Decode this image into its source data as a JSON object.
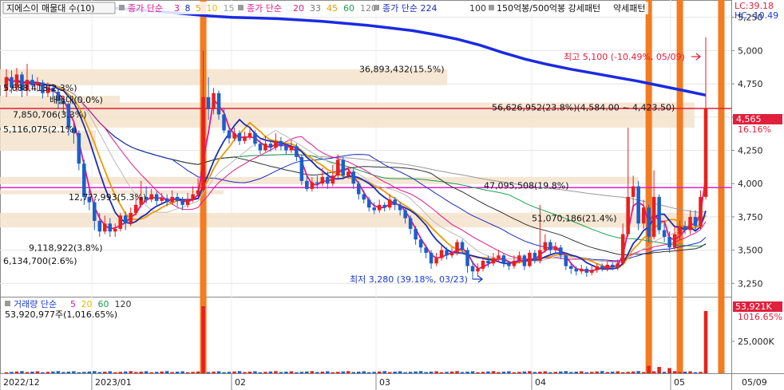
{
  "legend": {
    "title": "지에스이 매물대 수(10)",
    "ma1": {
      "label": "종가 단순",
      "periods": [
        {
          "v": "3",
          "color": "#e0188c"
        },
        {
          "v": "8",
          "color": "#1a2bbd"
        },
        {
          "v": "5",
          "color": "#e89a00"
        },
        {
          "v": "10",
          "color": "#e0c000"
        },
        {
          "v": "15",
          "color": "#9a9a9a"
        }
      ]
    },
    "ma2": {
      "label": "종가 단순",
      "periods": [
        {
          "v": "20",
          "color": "#d4208a"
        },
        {
          "v": "33",
          "color": "#777777"
        },
        {
          "v": "45",
          "color": "#e89a00"
        },
        {
          "v": "60",
          "color": "#1aa050"
        },
        {
          "v": "120",
          "color": "#888888"
        }
      ]
    },
    "ma3": {
      "label": "종가 단순 224",
      "periods": [
        {
          "v": "100",
          "color": "#333333"
        }
      ]
    },
    "pattern": "150억봉/500억봉 강세패턴",
    "pattern2": "약세패턴"
  },
  "top_right": {
    "lc": "LC:39.18",
    "hc": "HC:-10.49"
  },
  "price_axis": [
    "5,250",
    "5,000",
    "4,750",
    "4,500",
    "4,250",
    "4,000",
    "3,750",
    "3,500",
    "3,250"
  ],
  "current_price": {
    "value": "4,565",
    "change": "16.16%"
  },
  "volume_axis": [
    "25,000K"
  ],
  "current_volume": {
    "value": "53,921K",
    "change": "1016.65%"
  },
  "date_axis": [
    "2022/12",
    "2023/01",
    "02",
    "03",
    "04",
    "05",
    "05/09"
  ],
  "volume_legend": {
    "label": "거래량 단순",
    "periods": [
      {
        "v": "5",
        "color": "#e0188c"
      },
      {
        "v": "20",
        "color": "#e0c000"
      },
      {
        "v": "60",
        "color": "#1aa050"
      },
      {
        "v": "120",
        "color": "#333333"
      }
    ],
    "value": "53,920,977주(1,016.65%)"
  },
  "annotations": {
    "high": "최고 5,100 (-10.49%, 05/09)",
    "low": "최저 3,280 (39.18%, 03/23)",
    "vol_profile": [
      "36,893,432(15.5%)",
      "5,688,413(2.3%)",
      "배물대(0.0%)",
      "56,626,952(23.8%)(4,584.00 ~ 4,423.50)",
      "7,850,706(3.3%)",
      "5,116,075(2.1%)",
      "47,095,508(19.8%)",
      "12,7??,993(5.3%)",
      "51,070,186(21.4%)",
      "9,118,922(3.8%)",
      "6,134,700(2.6%)"
    ]
  },
  "chart_data": {
    "type": "candlestick",
    "price_ylim": [
      3150,
      5380
    ],
    "horizontal_lines": [
      {
        "value": 4565,
        "color": "#e0203c"
      },
      {
        "value": 3970,
        "color": "#e020c8"
      }
    ],
    "bars": [
      {
        "o": 4700,
        "c": 4800,
        "h": 4860,
        "l": 4650
      },
      {
        "o": 4800,
        "c": 4720,
        "h": 4850,
        "l": 4680
      },
      {
        "o": 4720,
        "c": 4820,
        "h": 4870,
        "l": 4690
      },
      {
        "o": 4820,
        "c": 4700,
        "h": 4840,
        "l": 4650
      },
      {
        "o": 4700,
        "c": 4780,
        "h": 4900,
        "l": 4660
      },
      {
        "o": 4780,
        "c": 4740,
        "h": 4820,
        "l": 4700
      },
      {
        "o": 4740,
        "c": 4760,
        "h": 4800,
        "l": 4690
      },
      {
        "o": 4760,
        "c": 4680,
        "h": 4780,
        "l": 4640
      },
      {
        "o": 4680,
        "c": 4720,
        "h": 4760,
        "l": 4650
      },
      {
        "o": 4720,
        "c": 4690,
        "h": 4750,
        "l": 4640
      },
      {
        "o": 4690,
        "c": 4620,
        "h": 4700,
        "l": 4560
      },
      {
        "o": 4620,
        "c": 4600,
        "h": 4640,
        "l": 4520
      },
      {
        "o": 4600,
        "c": 4420,
        "h": 4610,
        "l": 4360
      },
      {
        "o": 4420,
        "c": 4380,
        "h": 4460,
        "l": 4300
      },
      {
        "o": 4380,
        "c": 4150,
        "h": 4400,
        "l": 4100
      },
      {
        "o": 4150,
        "c": 3900,
        "h": 4180,
        "l": 3840
      },
      {
        "o": 3900,
        "c": 3860,
        "h": 3960,
        "l": 3800
      },
      {
        "o": 3860,
        "c": 3720,
        "h": 3880,
        "l": 3650
      },
      {
        "o": 3720,
        "c": 3640,
        "h": 3780,
        "l": 3600
      },
      {
        "o": 3640,
        "c": 3700,
        "h": 3760,
        "l": 3620
      },
      {
        "o": 3700,
        "c": 3640,
        "h": 3740,
        "l": 3600
      },
      {
        "o": 3640,
        "c": 3660,
        "h": 3700,
        "l": 3600
      },
      {
        "o": 3660,
        "c": 3760,
        "h": 3780,
        "l": 3640
      },
      {
        "o": 3760,
        "c": 3700,
        "h": 3790,
        "l": 3650
      },
      {
        "o": 3700,
        "c": 3780,
        "h": 3820,
        "l": 3680
      },
      {
        "o": 3780,
        "c": 3840,
        "h": 3900,
        "l": 3760
      },
      {
        "o": 3840,
        "c": 3900,
        "h": 4020,
        "l": 3820
      },
      {
        "o": 3900,
        "c": 3880,
        "h": 3980,
        "l": 3850
      },
      {
        "o": 3880,
        "c": 3920,
        "h": 3960,
        "l": 3860
      },
      {
        "o": 3920,
        "c": 3870,
        "h": 3940,
        "l": 3840
      },
      {
        "o": 3870,
        "c": 3890,
        "h": 3930,
        "l": 3840
      },
      {
        "o": 3890,
        "c": 3860,
        "h": 3920,
        "l": 3830
      },
      {
        "o": 3860,
        "c": 3900,
        "h": 3950,
        "l": 3840
      },
      {
        "o": 3900,
        "c": 3870,
        "h": 3930,
        "l": 3830
      },
      {
        "o": 3870,
        "c": 3840,
        "h": 3900,
        "l": 3800
      },
      {
        "o": 3840,
        "c": 3880,
        "h": 3930,
        "l": 3820
      },
      {
        "o": 3880,
        "c": 3920,
        "h": 3980,
        "l": 3860
      },
      {
        "o": 3920,
        "c": 3950,
        "h": 4040,
        "l": 3900
      },
      {
        "o": 3950,
        "c": 4650,
        "h": 5000,
        "l": 3940
      },
      {
        "o": 4650,
        "c": 4560,
        "h": 4800,
        "l": 4480
      },
      {
        "o": 4560,
        "c": 4680,
        "h": 4720,
        "l": 4520
      },
      {
        "o": 4680,
        "c": 4520,
        "h": 4700,
        "l": 4480
      },
      {
        "o": 4520,
        "c": 4400,
        "h": 4560,
        "l": 4380
      },
      {
        "o": 4400,
        "c": 4340,
        "h": 4430,
        "l": 4300
      },
      {
        "o": 4340,
        "c": 4380,
        "h": 4420,
        "l": 4320
      },
      {
        "o": 4380,
        "c": 4320,
        "h": 4400,
        "l": 4290
      },
      {
        "o": 4320,
        "c": 4350,
        "h": 4390,
        "l": 4300
      },
      {
        "o": 4350,
        "c": 4380,
        "h": 4420,
        "l": 4330
      },
      {
        "o": 4380,
        "c": 4300,
        "h": 4400,
        "l": 4280
      },
      {
        "o": 4300,
        "c": 4250,
        "h": 4320,
        "l": 4220
      },
      {
        "o": 4250,
        "c": 4300,
        "h": 4360,
        "l": 4240
      },
      {
        "o": 4300,
        "c": 4270,
        "h": 4320,
        "l": 4240
      },
      {
        "o": 4270,
        "c": 4320,
        "h": 4380,
        "l": 4250
      },
      {
        "o": 4320,
        "c": 4280,
        "h": 4350,
        "l": 4250
      },
      {
        "o": 4280,
        "c": 4250,
        "h": 4300,
        "l": 4220
      },
      {
        "o": 4250,
        "c": 4280,
        "h": 4330,
        "l": 4230
      },
      {
        "o": 4280,
        "c": 4200,
        "h": 4300,
        "l": 4170
      },
      {
        "o": 4200,
        "c": 4020,
        "h": 4220,
        "l": 3990
      },
      {
        "o": 4020,
        "c": 3960,
        "h": 4060,
        "l": 3940
      },
      {
        "o": 3960,
        "c": 4010,
        "h": 4050,
        "l": 3940
      },
      {
        "o": 4010,
        "c": 4000,
        "h": 4060,
        "l": 3960
      },
      {
        "o": 4000,
        "c": 4050,
        "h": 4120,
        "l": 3980
      },
      {
        "o": 4050,
        "c": 4000,
        "h": 4090,
        "l": 3960
      },
      {
        "o": 4000,
        "c": 4060,
        "h": 4140,
        "l": 3980
      },
      {
        "o": 4060,
        "c": 4180,
        "h": 4220,
        "l": 4040
      },
      {
        "o": 4180,
        "c": 4060,
        "h": 4200,
        "l": 4030
      },
      {
        "o": 4060,
        "c": 4090,
        "h": 4130,
        "l": 4040
      },
      {
        "o": 4090,
        "c": 4000,
        "h": 4110,
        "l": 3960
      },
      {
        "o": 4000,
        "c": 3920,
        "h": 4020,
        "l": 3880
      },
      {
        "o": 3920,
        "c": 3880,
        "h": 3950,
        "l": 3850
      },
      {
        "o": 3880,
        "c": 3820,
        "h": 3900,
        "l": 3790
      },
      {
        "o": 3820,
        "c": 3800,
        "h": 3860,
        "l": 3770
      },
      {
        "o": 3800,
        "c": 3840,
        "h": 3880,
        "l": 3780
      },
      {
        "o": 3840,
        "c": 3820,
        "h": 3860,
        "l": 3790
      },
      {
        "o": 3820,
        "c": 3880,
        "h": 3920,
        "l": 3800
      },
      {
        "o": 3880,
        "c": 3840,
        "h": 3900,
        "l": 3800
      },
      {
        "o": 3840,
        "c": 3800,
        "h": 3860,
        "l": 3760
      },
      {
        "o": 3800,
        "c": 3740,
        "h": 3820,
        "l": 3700
      },
      {
        "o": 3740,
        "c": 3660,
        "h": 3760,
        "l": 3620
      },
      {
        "o": 3660,
        "c": 3580,
        "h": 3680,
        "l": 3540
      },
      {
        "o": 3580,
        "c": 3520,
        "h": 3600,
        "l": 3480
      },
      {
        "o": 3520,
        "c": 3480,
        "h": 3540,
        "l": 3440
      },
      {
        "o": 3480,
        "c": 3400,
        "h": 3500,
        "l": 3360
      },
      {
        "o": 3400,
        "c": 3440,
        "h": 3480,
        "l": 3380
      },
      {
        "o": 3440,
        "c": 3500,
        "h": 3540,
        "l": 3420
      },
      {
        "o": 3500,
        "c": 3460,
        "h": 3520,
        "l": 3430
      },
      {
        "o": 3460,
        "c": 3480,
        "h": 3520,
        "l": 3440
      },
      {
        "o": 3480,
        "c": 3560,
        "h": 3580,
        "l": 3460
      },
      {
        "o": 3560,
        "c": 3500,
        "h": 3580,
        "l": 3470
      },
      {
        "o": 3500,
        "c": 3380,
        "h": 3520,
        "l": 3330
      },
      {
        "o": 3380,
        "c": 3340,
        "h": 3420,
        "l": 3280
      },
      {
        "o": 3340,
        "c": 3360,
        "h": 3400,
        "l": 3300
      },
      {
        "o": 3360,
        "c": 3420,
        "h": 3440,
        "l": 3340
      },
      {
        "o": 3420,
        "c": 3400,
        "h": 3460,
        "l": 3370
      },
      {
        "o": 3400,
        "c": 3440,
        "h": 3480,
        "l": 3380
      },
      {
        "o": 3440,
        "c": 3460,
        "h": 3500,
        "l": 3410
      },
      {
        "o": 3460,
        "c": 3400,
        "h": 3480,
        "l": 3370
      },
      {
        "o": 3400,
        "c": 3380,
        "h": 3420,
        "l": 3350
      },
      {
        "o": 3380,
        "c": 3420,
        "h": 3460,
        "l": 3360
      },
      {
        "o": 3420,
        "c": 3460,
        "h": 3490,
        "l": 3400
      },
      {
        "o": 3460,
        "c": 3380,
        "h": 3470,
        "l": 3350
      },
      {
        "o": 3380,
        "c": 3480,
        "h": 3500,
        "l": 3370
      },
      {
        "o": 3480,
        "c": 3420,
        "h": 3500,
        "l": 3400
      },
      {
        "o": 3420,
        "c": 3500,
        "h": 3840,
        "l": 3400
      },
      {
        "o": 3500,
        "c": 3560,
        "h": 3620,
        "l": 3480
      },
      {
        "o": 3560,
        "c": 3500,
        "h": 3580,
        "l": 3470
      },
      {
        "o": 3500,
        "c": 3520,
        "h": 3560,
        "l": 3480
      },
      {
        "o": 3520,
        "c": 3460,
        "h": 3540,
        "l": 3430
      },
      {
        "o": 3460,
        "c": 3380,
        "h": 3480,
        "l": 3350
      },
      {
        "o": 3380,
        "c": 3360,
        "h": 3400,
        "l": 3320
      },
      {
        "o": 3360,
        "c": 3340,
        "h": 3380,
        "l": 3310
      },
      {
        "o": 3340,
        "c": 3360,
        "h": 3390,
        "l": 3320
      },
      {
        "o": 3360,
        "c": 3330,
        "h": 3380,
        "l": 3300
      },
      {
        "o": 3330,
        "c": 3350,
        "h": 3380,
        "l": 3310
      },
      {
        "o": 3350,
        "c": 3380,
        "h": 3400,
        "l": 3330
      },
      {
        "o": 3380,
        "c": 3360,
        "h": 3400,
        "l": 3340
      },
      {
        "o": 3360,
        "c": 3390,
        "h": 3410,
        "l": 3340
      },
      {
        "o": 3390,
        "c": 3370,
        "h": 3410,
        "l": 3350
      },
      {
        "o": 3370,
        "c": 3400,
        "h": 3430,
        "l": 3350
      },
      {
        "o": 3400,
        "c": 3620,
        "h": 3700,
        "l": 3390
      },
      {
        "o": 3620,
        "c": 3900,
        "h": 4420,
        "l": 3600
      },
      {
        "o": 3900,
        "c": 3980,
        "h": 4060,
        "l": 3800
      },
      {
        "o": 3980,
        "c": 3700,
        "h": 4020,
        "l": 3650
      },
      {
        "o": 3700,
        "c": 3820,
        "h": 3880,
        "l": 3660
      },
      {
        "o": 3820,
        "c": 3600,
        "h": 3840,
        "l": 3560
      },
      {
        "o": 3600,
        "c": 3900,
        "h": 4100,
        "l": 3580
      },
      {
        "o": 3900,
        "c": 3650,
        "h": 3920,
        "l": 3620
      },
      {
        "o": 3650,
        "c": 3600,
        "h": 3700,
        "l": 3560
      },
      {
        "o": 3600,
        "c": 3520,
        "h": 3640,
        "l": 3480
      },
      {
        "o": 3520,
        "c": 3620,
        "h": 3680,
        "l": 3500
      },
      {
        "o": 3620,
        "c": 3680,
        "h": 3720,
        "l": 3580
      },
      {
        "o": 3680,
        "c": 3650,
        "h": 3720,
        "l": 3620
      },
      {
        "o": 3650,
        "c": 3750,
        "h": 3800,
        "l": 3620
      },
      {
        "o": 3750,
        "c": 3680,
        "h": 3800,
        "l": 3650
      },
      {
        "o": 3680,
        "c": 3900,
        "h": 3950,
        "l": 3660
      },
      {
        "o": 3900,
        "c": 4565,
        "h": 5100,
        "l": 3880
      }
    ],
    "ma224": [
      5300,
      5310,
      5320,
      5325,
      5320,
      5315,
      5305,
      5290,
      5275,
      5260,
      5250,
      5245,
      5240,
      5230,
      5220,
      5205,
      5190,
      5170,
      5150,
      5120,
      5085,
      5040,
      4985,
      4935,
      4895,
      4860,
      4830,
      4800,
      4770,
      4735,
      4700,
      4665
    ],
    "volume_ylim": [
      0,
      58000
    ],
    "volume_spikes": [
      {
        "bar": 38,
        "value": 58000,
        "color": "red"
      },
      {
        "bar": 124,
        "value": 6500,
        "color": "red"
      },
      {
        "bar": 126,
        "value": 5500,
        "color": "red"
      },
      {
        "bar": 128,
        "value": 4500,
        "color": "red"
      },
      {
        "bar": 135,
        "value": 53921,
        "color": "red"
      }
    ],
    "highlight_bars": [
      38,
      124,
      130,
      138
    ]
  }
}
